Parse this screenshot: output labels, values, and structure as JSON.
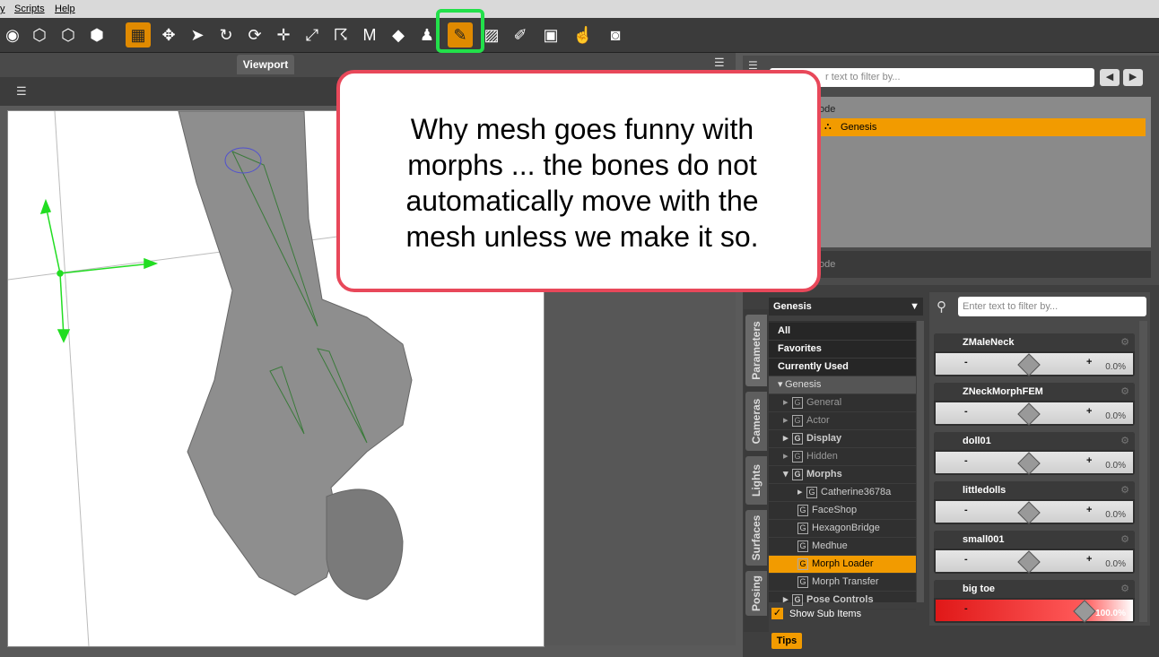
{
  "menu": {
    "items": [
      "y",
      "Scripts",
      "Help"
    ]
  },
  "toolbar": {
    "tools": [
      "orbit-icon",
      "node-add-icon",
      "node-remove-icon",
      "node-cube-icon",
      "grid-icon",
      "universal-tool-icon",
      "pointer-icon",
      "rotate-pointer-icon",
      "rotate-icon",
      "translate-icon",
      "scale-icon",
      "bend-icon",
      "morph-m-icon",
      "geometry-editor-icon",
      "figure-icon",
      "joint-editor-icon",
      "weight-map-icon",
      "edit-image-icon",
      "camera-plus-icon",
      "hand-pointer-icon",
      "camera-icon"
    ],
    "active_tool": "joint-editor-icon"
  },
  "viewport": {
    "tab_label": "Viewport"
  },
  "callout": {
    "text": "Why mesh goes funny with morphs ... the bones do not automatically move with the mesh unless we make it so."
  },
  "scene": {
    "filter_placeholder": "Enter text to filter by...",
    "filter_visible": "r text to filter by...",
    "header_partial": "ode",
    "selected_node": "Genesis",
    "footer_partial": "ode"
  },
  "parameters_pane": {
    "vertical_tabs": [
      "Parameters",
      "Cameras",
      "Lights",
      "Surfaces",
      "Posing"
    ],
    "node_selector": "Genesis",
    "filter_placeholder": "Enter text to filter by...",
    "tree": [
      {
        "label": "All",
        "level": 0,
        "kind": "group"
      },
      {
        "label": "Favorites",
        "level": 0,
        "kind": "group"
      },
      {
        "label": "Currently Used",
        "level": 0,
        "kind": "group"
      },
      {
        "label": "Genesis",
        "level": 0,
        "kind": "root"
      },
      {
        "label": "General",
        "level": 1,
        "kind": "cat",
        "dim": true
      },
      {
        "label": "Actor",
        "level": 1,
        "kind": "cat",
        "dim": true
      },
      {
        "label": "Display",
        "level": 1,
        "kind": "cat"
      },
      {
        "label": "Hidden",
        "level": 1,
        "kind": "cat",
        "dim": true
      },
      {
        "label": "Morphs",
        "level": 1,
        "kind": "cat"
      },
      {
        "label": "Catherine3678a",
        "level": 2,
        "kind": "cat"
      },
      {
        "label": "FaceShop",
        "level": 2,
        "kind": "leaf"
      },
      {
        "label": "HexagonBridge",
        "level": 2,
        "kind": "leaf"
      },
      {
        "label": "Medhue",
        "level": 2,
        "kind": "leaf"
      },
      {
        "label": "Morph Loader",
        "level": 2,
        "kind": "leaf",
        "selected": true
      },
      {
        "label": "Morph Transfer",
        "level": 2,
        "kind": "leaf"
      },
      {
        "label": "Pose Controls",
        "level": 1,
        "kind": "cat"
      }
    ],
    "show_sub_items": "Show Sub Items",
    "tips_label": "Tips",
    "params": [
      {
        "name": "ZMaleNeck",
        "value": "0.0%",
        "fraction": 0.0
      },
      {
        "name": "ZNeckMorphFEM",
        "value": "0.0%",
        "fraction": 0.0
      },
      {
        "name": "doll01",
        "value": "0.0%",
        "fraction": 0.0
      },
      {
        "name": "littledolls",
        "value": "0.0%",
        "fraction": 0.0
      },
      {
        "name": "small001",
        "value": "0.0%",
        "fraction": 0.0
      },
      {
        "name": "big toe",
        "value": "100.0%",
        "fraction": 1.0
      }
    ]
  },
  "colors": {
    "accent": "#f29b00",
    "highlight": "#22e04a",
    "callout_border": "#e8485a",
    "active_param": "#e01818"
  }
}
